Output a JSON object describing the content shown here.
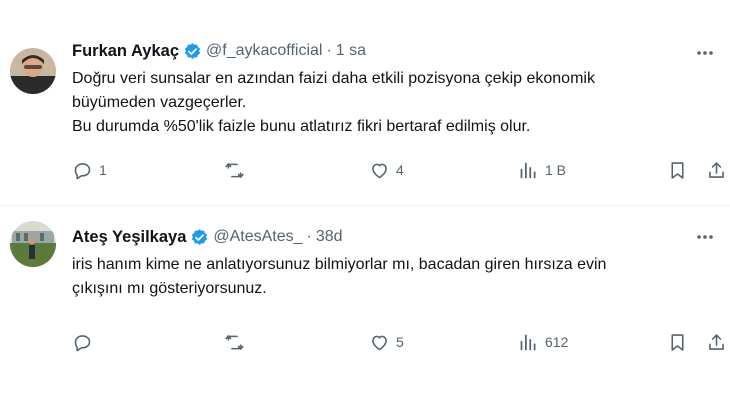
{
  "tweets": [
    {
      "name": "Furkan Aykaç",
      "handle": "@f_aykacofficial",
      "separator": "·",
      "time": "1 sa",
      "lines": [
        "Doğru veri sunsalar en azından faizi daha etkili pozisyona çekip ekonomik",
        "büyümeden vazgeçerler.",
        "Bu durumda %50'lik faizle bunu atlatırız fikri bertaraf edilmiş olur."
      ],
      "replies": "1",
      "retweets": "",
      "likes": "4",
      "views": "1 B"
    },
    {
      "name": "Ateş Yeşilkaya",
      "handle": "@AtesAtes_",
      "separator": "·",
      "time": "38d",
      "lines": [
        "iris hanım kime ne anlatıyorsunuz bilmiyorlar mı, bacadan giren hırsıza evin",
        "çıkışını mı gösteriyorsunuz."
      ],
      "replies": "",
      "retweets": "",
      "likes": "5",
      "views": "612"
    }
  ],
  "colors": {
    "verified": "#1d9bf0",
    "muted": "#536471",
    "text": "#0f1419"
  },
  "icons": [
    "verified-badge-icon",
    "more-icon",
    "reply-icon",
    "retweet-icon",
    "like-icon",
    "views-icon",
    "bookmark-icon",
    "share-icon"
  ]
}
